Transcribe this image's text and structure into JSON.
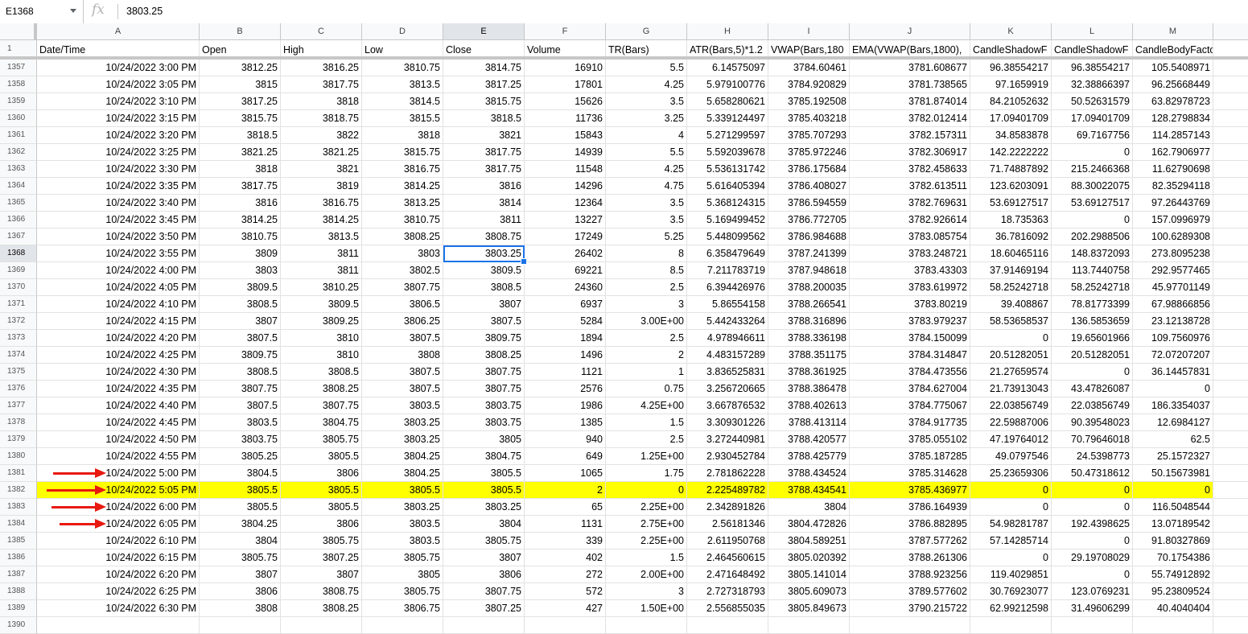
{
  "namebox": "E1368",
  "fx_label": "fx",
  "formula_value": "3803.25",
  "columns": [
    "A",
    "B",
    "C",
    "D",
    "E",
    "F",
    "G",
    "H",
    "I",
    "J",
    "K",
    "L",
    "M"
  ],
  "header_row_number": "1",
  "headers": [
    "Date/Time",
    "Open",
    "High",
    "Low",
    "Close",
    "Volume",
    "TR(Bars)",
    "ATR(Bars,5)*1.2",
    "VWAP(Bars,180",
    "EMA(VWAP(Bars,1800),",
    "CandleShadowF",
    "CandleShadowF",
    "CandleBodyFactor(Bars"
  ],
  "rows": [
    {
      "n": "1357",
      "c": [
        "10/24/2022 3:00 PM",
        "3812.25",
        "3816.25",
        "3810.75",
        "3814.75",
        "16910",
        "5.5",
        "6.14575097",
        "3784.60461",
        "3781.608677",
        "96.38554217",
        "96.38554217",
        "105.5408971"
      ]
    },
    {
      "n": "1358",
      "c": [
        "10/24/2022 3:05 PM",
        "3815",
        "3817.75",
        "3813.5",
        "3817.25",
        "17801",
        "4.25",
        "5.979100776",
        "3784.920829",
        "3781.738565",
        "97.1659919",
        "32.38866397",
        "96.25668449"
      ]
    },
    {
      "n": "1359",
      "c": [
        "10/24/2022 3:10 PM",
        "3817.25",
        "3818",
        "3814.5",
        "3815.75",
        "15626",
        "3.5",
        "5.658280621",
        "3785.192508",
        "3781.874014",
        "84.21052632",
        "50.52631579",
        "63.82978723"
      ]
    },
    {
      "n": "1360",
      "c": [
        "10/24/2022 3:15 PM",
        "3815.75",
        "3818.75",
        "3815.5",
        "3818.5",
        "11736",
        "3.25",
        "5.339124497",
        "3785.403218",
        "3782.012414",
        "17.09401709",
        "17.09401709",
        "128.2798834"
      ]
    },
    {
      "n": "1361",
      "c": [
        "10/24/2022 3:20 PM",
        "3818.5",
        "3822",
        "3818",
        "3821",
        "15843",
        "4",
        "5.271299597",
        "3785.707293",
        "3782.157311",
        "34.8583878",
        "69.7167756",
        "114.2857143"
      ]
    },
    {
      "n": "1362",
      "c": [
        "10/24/2022 3:25 PM",
        "3821.25",
        "3821.25",
        "3815.75",
        "3817.75",
        "14939",
        "5.5",
        "5.592039678",
        "3785.972246",
        "3782.306917",
        "142.2222222",
        "0",
        "162.7906977"
      ]
    },
    {
      "n": "1363",
      "c": [
        "10/24/2022 3:30 PM",
        "3818",
        "3821",
        "3816.75",
        "3817.75",
        "11548",
        "4.25",
        "5.536131742",
        "3786.175684",
        "3782.458633",
        "71.74887892",
        "215.2466368",
        "11.62790698"
      ]
    },
    {
      "n": "1364",
      "c": [
        "10/24/2022 3:35 PM",
        "3817.75",
        "3819",
        "3814.25",
        "3816",
        "14296",
        "4.75",
        "5.616405394",
        "3786.408027",
        "3782.613511",
        "123.6203091",
        "88.30022075",
        "82.35294118"
      ]
    },
    {
      "n": "1365",
      "c": [
        "10/24/2022 3:40 PM",
        "3816",
        "3816.75",
        "3813.25",
        "3814",
        "12364",
        "3.5",
        "5.368124315",
        "3786.594559",
        "3782.769631",
        "53.69127517",
        "53.69127517",
        "97.26443769"
      ]
    },
    {
      "n": "1366",
      "c": [
        "10/24/2022 3:45 PM",
        "3814.25",
        "3814.25",
        "3810.75",
        "3811",
        "13227",
        "3.5",
        "5.169499452",
        "3786.772705",
        "3782.926614",
        "18.735363",
        "0",
        "157.0996979"
      ]
    },
    {
      "n": "1367",
      "c": [
        "10/24/2022 3:50 PM",
        "3810.75",
        "3813.5",
        "3808.25",
        "3808.75",
        "17249",
        "5.25",
        "5.448099562",
        "3786.984688",
        "3783.085754",
        "36.7816092",
        "202.2988506",
        "100.6289308"
      ]
    },
    {
      "n": "1368",
      "c": [
        "10/24/2022 3:55 PM",
        "3809",
        "3811",
        "3803",
        "3803.25",
        "26402",
        "8",
        "6.358479649",
        "3787.241399",
        "3783.248721",
        "18.60465116",
        "148.8372093",
        "273.8095238"
      ]
    },
    {
      "n": "1369",
      "c": [
        "10/24/2022 4:00 PM",
        "3803",
        "3811",
        "3802.5",
        "3809.5",
        "69221",
        "8.5",
        "7.211783719",
        "3787.948618",
        "3783.43303",
        "37.91469194",
        "113.7440758",
        "292.9577465"
      ]
    },
    {
      "n": "1370",
      "c": [
        "10/24/2022 4:05 PM",
        "3809.5",
        "3810.25",
        "3807.75",
        "3808.5",
        "24360",
        "2.5",
        "6.394426976",
        "3788.200035",
        "3783.619972",
        "58.25242718",
        "58.25242718",
        "45.97701149"
      ]
    },
    {
      "n": "1371",
      "c": [
        "10/24/2022 4:10 PM",
        "3808.5",
        "3809.5",
        "3806.5",
        "3807",
        "6937",
        "3",
        "5.86554158",
        "3788.266541",
        "3783.80219",
        "39.408867",
        "78.81773399",
        "67.98866856"
      ]
    },
    {
      "n": "1372",
      "c": [
        "10/24/2022 4:15 PM",
        "3807",
        "3809.25",
        "3806.25",
        "3807.5",
        "5284",
        "3.00E+00",
        "5.442433264",
        "3788.316896",
        "3783.979237",
        "58.53658537",
        "136.5853659",
        "23.12138728"
      ]
    },
    {
      "n": "1373",
      "c": [
        "10/24/2022 4:20 PM",
        "3807.5",
        "3810",
        "3807.5",
        "3809.75",
        "1894",
        "2.5",
        "4.978946611",
        "3788.336198",
        "3784.150099",
        "0",
        "19.65601966",
        "109.7560976"
      ]
    },
    {
      "n": "1374",
      "c": [
        "10/24/2022 4:25 PM",
        "3809.75",
        "3810",
        "3808",
        "3808.25",
        "1496",
        "2",
        "4.483157289",
        "3788.351175",
        "3784.314847",
        "20.51282051",
        "20.51282051",
        "72.07207207"
      ]
    },
    {
      "n": "1375",
      "c": [
        "10/24/2022 4:30 PM",
        "3808.5",
        "3808.5",
        "3807.5",
        "3807.75",
        "1121",
        "1",
        "3.836525831",
        "3788.361925",
        "3784.473556",
        "21.27659574",
        "0",
        "36.14457831"
      ]
    },
    {
      "n": "1376",
      "c": [
        "10/24/2022 4:35 PM",
        "3807.75",
        "3808.25",
        "3807.5",
        "3807.75",
        "2576",
        "0.75",
        "3.256720665",
        "3788.386478",
        "3784.627004",
        "21.73913043",
        "43.47826087",
        "0"
      ]
    },
    {
      "n": "1377",
      "c": [
        "10/24/2022 4:40 PM",
        "3807.5",
        "3807.75",
        "3803.5",
        "3803.75",
        "1986",
        "4.25E+00",
        "3.667876532",
        "3788.402613",
        "3784.775067",
        "22.03856749",
        "22.03856749",
        "186.3354037"
      ]
    },
    {
      "n": "1378",
      "c": [
        "10/24/2022 4:45 PM",
        "3803.5",
        "3804.75",
        "3803.25",
        "3803.75",
        "1385",
        "1.5",
        "3.309301226",
        "3788.413114",
        "3784.917735",
        "22.59887006",
        "90.39548023",
        "12.6984127"
      ]
    },
    {
      "n": "1379",
      "c": [
        "10/24/2022 4:50 PM",
        "3803.75",
        "3805.75",
        "3803.25",
        "3805",
        "940",
        "2.5",
        "3.272440981",
        "3788.420577",
        "3785.055102",
        "47.19764012",
        "70.79646018",
        "62.5"
      ]
    },
    {
      "n": "1380",
      "c": [
        "10/24/2022 4:55 PM",
        "3805.25",
        "3805.5",
        "3804.25",
        "3804.75",
        "649",
        "1.25E+00",
        "2.930452784",
        "3788.425779",
        "3785.187285",
        "49.0797546",
        "24.5398773",
        "25.1572327"
      ]
    },
    {
      "n": "1381",
      "c": [
        "10/24/2022 5:00 PM",
        "3804.5",
        "3806",
        "3804.25",
        "3805.5",
        "1065",
        "1.75",
        "2.781862228",
        "3788.434524",
        "3785.314628",
        "25.23659306",
        "50.47318612",
        "50.15673981"
      ]
    },
    {
      "n": "1382",
      "c": [
        "10/24/2022 5:05 PM",
        "3805.5",
        "3805.5",
        "3805.5",
        "3805.5",
        "2",
        "0",
        "2.225489782",
        "3788.434541",
        "3785.436977",
        "0",
        "0",
        "0"
      ]
    },
    {
      "n": "1383",
      "c": [
        "10/24/2022 6:00 PM",
        "3805.5",
        "3805.5",
        "3803.25",
        "3803.25",
        "65",
        "2.25E+00",
        "2.342891826",
        "3804",
        "3786.164939",
        "0",
        "0",
        "116.5048544"
      ]
    },
    {
      "n": "1384",
      "c": [
        "10/24/2022 6:05 PM",
        "3804.25",
        "3806",
        "3803.5",
        "3804",
        "1131",
        "2.75E+00",
        "2.56181346",
        "3804.472826",
        "3786.882895",
        "54.98281787",
        "192.4398625",
        "13.07189542"
      ]
    },
    {
      "n": "1385",
      "c": [
        "10/24/2022 6:10 PM",
        "3804",
        "3805.75",
        "3803.5",
        "3805.75",
        "339",
        "2.25E+00",
        "2.611950768",
        "3804.589251",
        "3787.577262",
        "57.14285714",
        "0",
        "91.80327869"
      ]
    },
    {
      "n": "1386",
      "c": [
        "10/24/2022 6:15 PM",
        "3805.75",
        "3807.25",
        "3805.75",
        "3807",
        "402",
        "1.5",
        "2.464560615",
        "3805.020392",
        "3788.261306",
        "0",
        "29.19708029",
        "70.1754386"
      ]
    },
    {
      "n": "1387",
      "c": [
        "10/24/2022 6:20 PM",
        "3807",
        "3807",
        "3805",
        "3806",
        "272",
        "2.00E+00",
        "2.471648492",
        "3805.141014",
        "3788.923256",
        "119.4029851",
        "0",
        "55.74912892"
      ]
    },
    {
      "n": "1388",
      "c": [
        "10/24/2022 6:25 PM",
        "3806",
        "3808.75",
        "3805.75",
        "3807.75",
        "572",
        "3",
        "2.727318793",
        "3805.609073",
        "3789.577602",
        "30.76923077",
        "123.0769231",
        "95.23809524"
      ]
    },
    {
      "n": "1389",
      "c": [
        "10/24/2022 6:30 PM",
        "3808",
        "3808.25",
        "3806.75",
        "3807.25",
        "427",
        "1.50E+00",
        "2.556855035",
        "3805.849673",
        "3790.215722",
        "62.99212598",
        "31.49606299",
        "40.4040404"
      ]
    },
    {
      "n": "1390",
      "c": [
        "",
        "",
        "",
        "",
        "",
        "",
        "",
        "",
        "",
        "",
        "",
        "",
        ""
      ]
    }
  ],
  "highlight_row": "1382",
  "active_cell": {
    "row": "1368",
    "col": "E"
  },
  "arrow_rows": [
    "1381",
    "1382",
    "1383",
    "1384"
  ],
  "colors": {
    "highlight": "#ffff00",
    "selection": "#1a73e8",
    "arrow": "#e8190f"
  }
}
